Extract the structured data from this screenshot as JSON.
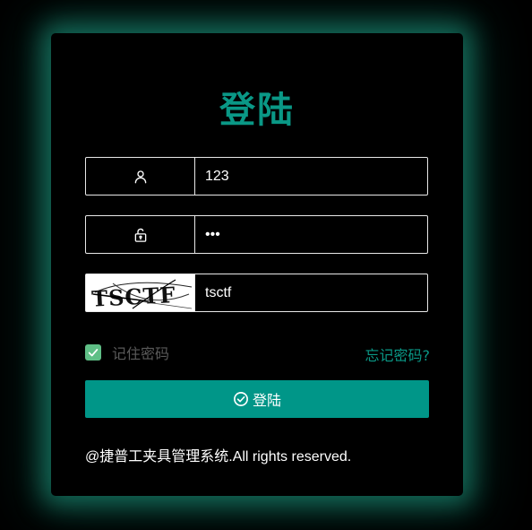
{
  "login": {
    "title": "登陆",
    "username": {
      "icon": "user-icon",
      "value": "123"
    },
    "password": {
      "icon": "lock-icon",
      "value": "•••"
    },
    "captcha": {
      "image_text": "TSCTF",
      "value": "tsctf"
    },
    "remember": {
      "label": "记住密码",
      "checked": true
    },
    "forgot_label": "忘记密码?",
    "submit_label": "登陆",
    "submit_icon": "check-circle-icon"
  },
  "footer": {
    "copyright": "@捷普工夹具管理系统.All rights reserved."
  },
  "colors": {
    "accent": "#009688",
    "title": "#0a9886",
    "checkbox": "#5fbf86",
    "glow": "#16786a",
    "background": "#000000"
  }
}
